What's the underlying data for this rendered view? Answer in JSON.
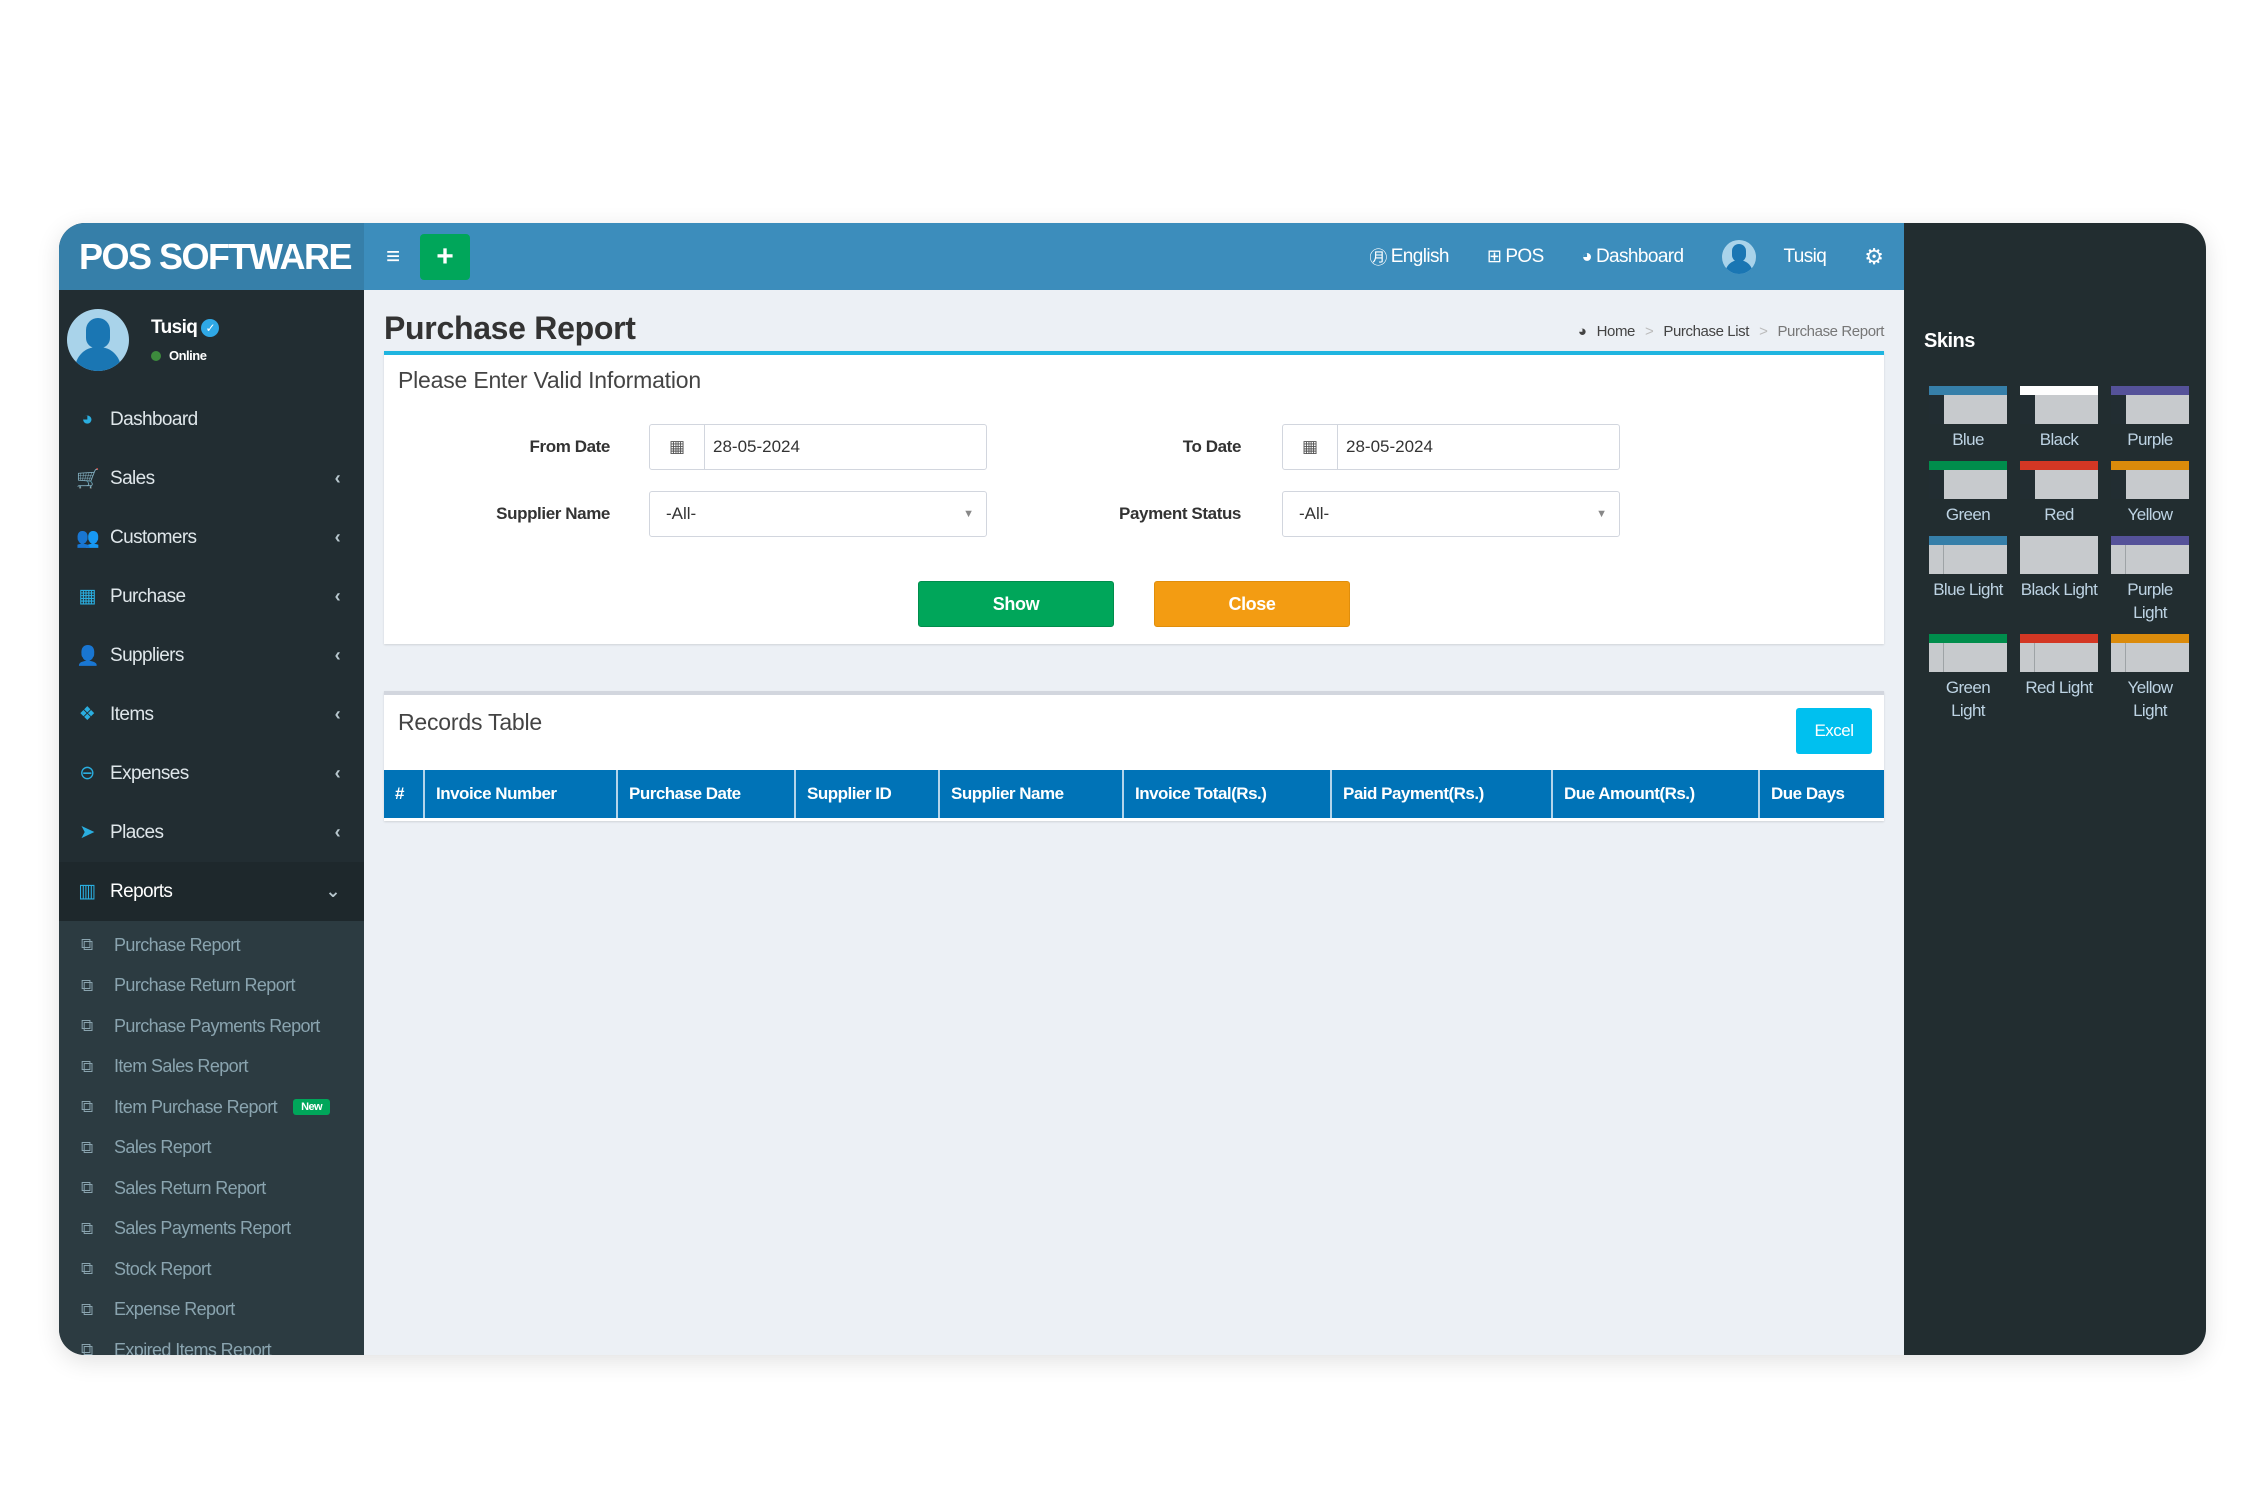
{
  "app": {
    "logo": "POS SOFTWARE"
  },
  "user": {
    "name": "Tusiq",
    "status": "Online"
  },
  "sidebar": {
    "items": [
      {
        "label": "Dashboard",
        "icon": "dashboard-icon",
        "glyph": "◕",
        "has_children": false
      },
      {
        "label": "Sales",
        "icon": "cart-icon",
        "glyph": "🛒",
        "has_children": true
      },
      {
        "label": "Customers",
        "icon": "users-icon",
        "glyph": "👥",
        "has_children": true
      },
      {
        "label": "Purchase",
        "icon": "grid-icon",
        "glyph": "▦",
        "has_children": true
      },
      {
        "label": "Suppliers",
        "icon": "user-plus-icon",
        "glyph": "👤",
        "has_children": true
      },
      {
        "label": "Items",
        "icon": "cubes-icon",
        "glyph": "❖",
        "has_children": true
      },
      {
        "label": "Expenses",
        "icon": "minus-circle-icon",
        "glyph": "⊖",
        "has_children": true
      },
      {
        "label": "Places",
        "icon": "paper-plane-icon",
        "glyph": "➤",
        "has_children": true
      },
      {
        "label": "Reports",
        "icon": "bar-chart-icon",
        "glyph": "▥",
        "has_children": true,
        "expanded": true
      }
    ],
    "chevron_collapsed": "‹",
    "chevron_expanded": "⌄",
    "reports_submenu": [
      {
        "label": "Purchase Report"
      },
      {
        "label": "Purchase Return Report"
      },
      {
        "label": "Purchase Payments Report"
      },
      {
        "label": "Item Sales Report"
      },
      {
        "label": "Item Purchase Report",
        "badge": "New"
      },
      {
        "label": "Sales Report"
      },
      {
        "label": "Sales Return Report"
      },
      {
        "label": "Sales Payments Report"
      },
      {
        "label": "Stock Report"
      },
      {
        "label": "Expense Report"
      },
      {
        "label": "Expired Items Report"
      }
    ]
  },
  "navbar": {
    "menu_icon": "≡",
    "add_icon": "+",
    "links": [
      {
        "label": "English",
        "icon": "language-icon",
        "glyph": "㊊"
      },
      {
        "label": "POS",
        "icon": "plus-square-icon",
        "glyph": "⊞"
      },
      {
        "label": "Dashboard",
        "icon": "dashboard-icon",
        "glyph": "◕"
      }
    ],
    "user_name": "Tusiq",
    "settings_icon": "⚙"
  },
  "page": {
    "title": "Purchase Report",
    "breadcrumb": {
      "home": "Home",
      "parent": "Purchase List",
      "current": "Purchase Report",
      "separator": ">"
    }
  },
  "form": {
    "title": "Please Enter Valid Information",
    "from_date": {
      "label": "From Date",
      "value": "28-05-2024"
    },
    "to_date": {
      "label": "To Date",
      "value": "28-05-2024"
    },
    "supplier_name": {
      "label": "Supplier Name",
      "value": "-All-"
    },
    "payment_status": {
      "label": "Payment Status",
      "value": "-All-"
    },
    "show_label": "Show",
    "close_label": "Close"
  },
  "records": {
    "title": "Records Table",
    "excel_label": "Excel",
    "columns": [
      "#",
      "Invoice Number",
      "Purchase Date",
      "Supplier ID",
      "Supplier Name",
      "Invoice Total(Rs.)",
      "Paid Payment(Rs.)",
      "Due Amount(Rs.)",
      "Due Days"
    ],
    "rows": []
  },
  "skins": {
    "title": "Skins",
    "items": [
      {
        "label": "Blue",
        "color": "#367fa9",
        "light": false
      },
      {
        "label": "Black",
        "color": "#fefefe",
        "light": false
      },
      {
        "label": "Purple",
        "color": "#555299",
        "light": false
      },
      {
        "label": "Green",
        "color": "#008d4c",
        "light": false
      },
      {
        "label": "Red",
        "color": "#d33724",
        "light": false
      },
      {
        "label": "Yellow",
        "color": "#db8b0b",
        "light": false
      },
      {
        "label": "Blue Light",
        "color": "#367fa9",
        "light": true
      },
      {
        "label": "Black Light",
        "color": "#c7cacd",
        "light": true
      },
      {
        "label": "Purple Light",
        "color": "#555299",
        "light": true
      },
      {
        "label": "Green Light",
        "color": "#008d4c",
        "light": true
      },
      {
        "label": "Red Light",
        "color": "#d33724",
        "light": true
      },
      {
        "label": "Yellow Light",
        "color": "#db8b0b",
        "light": true
      }
    ]
  },
  "colors": {
    "header": "#3c8dbc",
    "logo_bg": "#367fa9",
    "sidebar": "#222d32",
    "accent": "#1fb5e0",
    "success": "#00a65a",
    "warning": "#f39c12",
    "info": "#00c0ef",
    "table_header": "#0073b7"
  }
}
